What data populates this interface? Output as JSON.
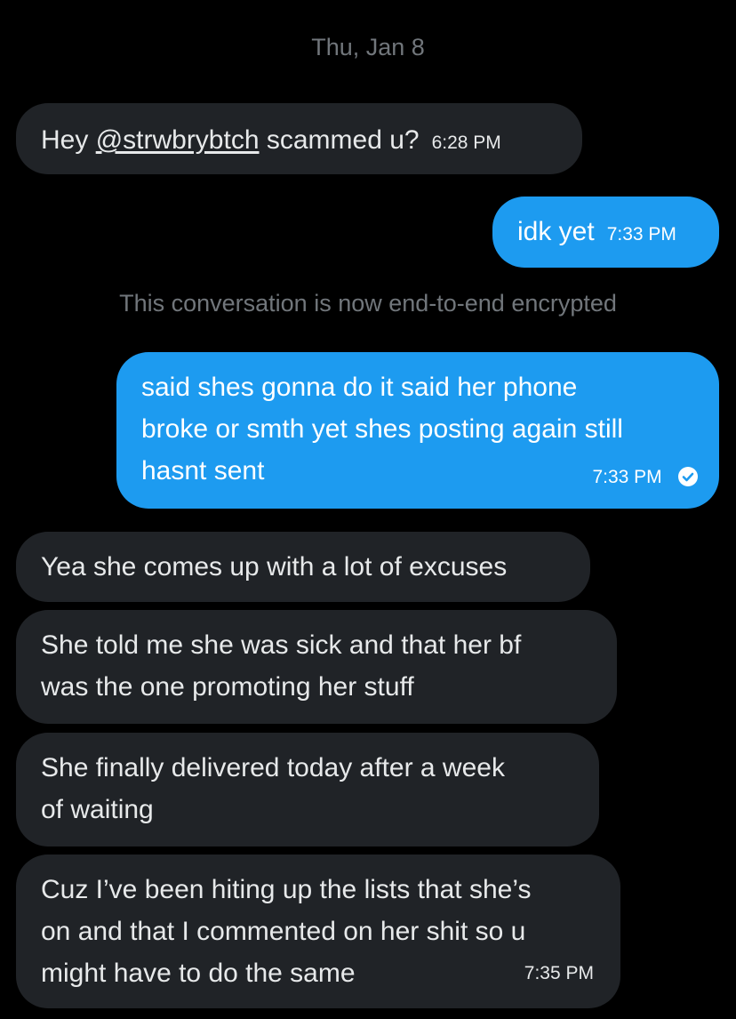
{
  "date_header": "Thu, Jan 8",
  "encryption_notice": "This conversation is now end-to-end encrypted",
  "messages": [
    {
      "direction": "received",
      "prefix": "Hey ",
      "mention": "@strwbrybtch",
      "suffix": " scammed u?",
      "time": "6:28 PM"
    },
    {
      "direction": "sent",
      "text": "idk yet",
      "time": "7:33 PM"
    },
    {
      "direction": "sent",
      "lines": [
        "said shes gonna do it said her phone",
        "broke or smth yet shes posting again still",
        "hasnt sent"
      ],
      "time": "7:33 PM",
      "status_icon": "seen-check-icon"
    },
    {
      "direction": "received",
      "text": "Yea she comes up with a lot of excuses"
    },
    {
      "direction": "received",
      "lines": [
        "She told me she was sick and that her bf",
        "was the one promoting her stuff"
      ]
    },
    {
      "direction": "received",
      "lines": [
        "She finally delivered today after a week",
        "of waiting"
      ]
    },
    {
      "direction": "received",
      "lines": [
        "Cuz I’ve been hiting up the lists that she’s",
        "on and that I commented on her shit so u",
        "might have to do the same"
      ],
      "time": "7:35 PM"
    }
  ],
  "colors": {
    "background": "#000000",
    "received_bubble": "#202327",
    "sent_bubble": "#1d9bf0",
    "muted_text": "#71767b"
  }
}
